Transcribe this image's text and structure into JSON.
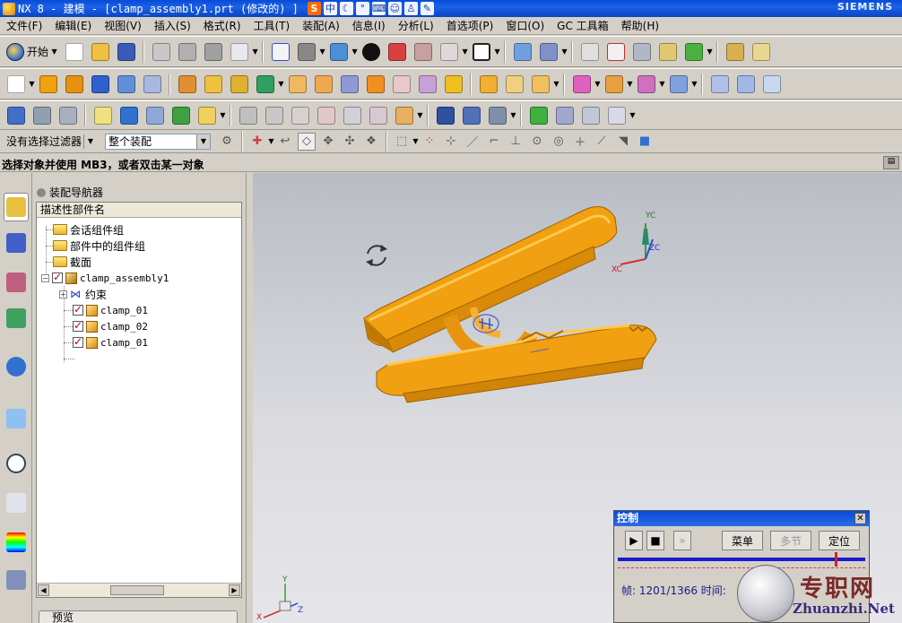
{
  "window": {
    "title": "NX 8 - 建模 - [clamp_assembly1.prt (修改的) ]",
    "brand": "SIEMENS"
  },
  "menu": [
    "文件(F)",
    "编辑(E)",
    "视图(V)",
    "插入(S)",
    "格式(R)",
    "工具(T)",
    "装配(A)",
    "信息(I)",
    "分析(L)",
    "首选项(P)",
    "窗口(O)",
    "GC 工具箱",
    "帮助(H)"
  ],
  "toolbar": {
    "start_label": "开始"
  },
  "filter": {
    "selection_filter": "没有选择过滤器",
    "assembly_scope": "整个装配"
  },
  "cue": "选择对象并使用 MB3，或者双击某一对象",
  "navigator": {
    "title": "装配导航器",
    "column_header": "描述性部件名",
    "items": [
      "会话组件组",
      "部件中的组件组",
      "截面",
      "clamp_assembly1",
      "约束",
      "clamp_01",
      "clamp_02",
      "clamp_01"
    ],
    "preview_label": "预览"
  },
  "viewport": {
    "axis_labels": [
      "YC",
      "ZC",
      "XC"
    ],
    "triad_labels": [
      "Y",
      "Z",
      "X"
    ]
  },
  "control_dialog": {
    "title": "控制",
    "menu_button": "菜单",
    "step_button": "多节",
    "position_button": "定位",
    "frame_label": "帧: 1201/1366 时间:",
    "frame_current": 1201,
    "frame_total": 1366
  },
  "watermark": {
    "cn": "专职网",
    "en": "Zhuanzhi.Net"
  },
  "colors": {
    "titlebar": "#0a4ad8",
    "part_orange": "#f0a010",
    "chrome": "#d4d0c8"
  }
}
